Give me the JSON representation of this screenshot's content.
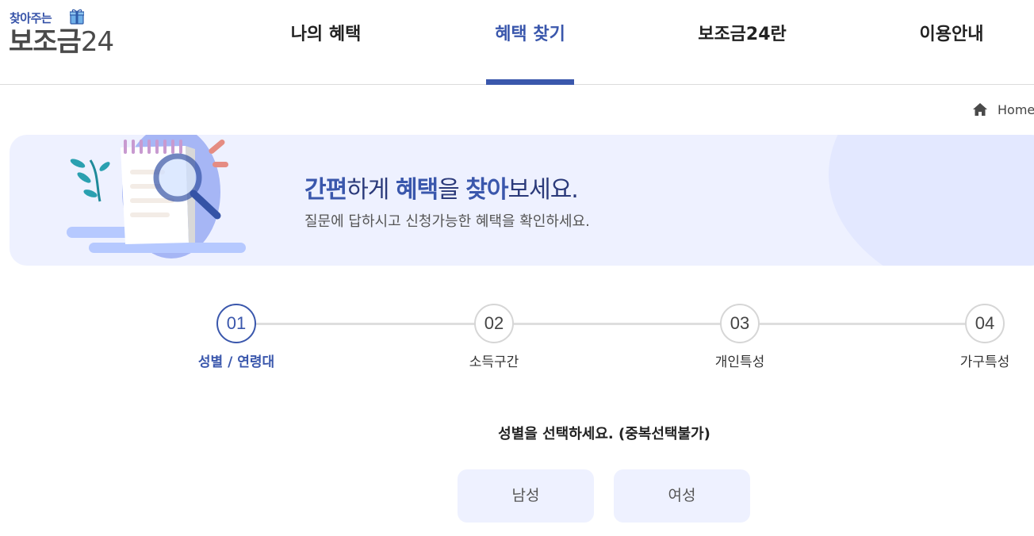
{
  "logo": {
    "top": "찾아주는",
    "main_text": "보조금",
    "main_num": "24"
  },
  "nav": {
    "items": [
      {
        "label": "나의 혜택"
      },
      {
        "label": "혜택 찾기"
      },
      {
        "label": "보조금24란"
      },
      {
        "label": "이용안내"
      }
    ],
    "active_index": 1
  },
  "breadcrumb": {
    "home": "Home"
  },
  "banner": {
    "title_parts": [
      "간편",
      "하게 ",
      "혜택",
      "을 ",
      "찾아",
      "보세요."
    ],
    "subtitle": "질문에 답하시고 신청가능한 혜택을 확인하세요."
  },
  "steps": [
    {
      "num": "01",
      "label": "성별 / 연령대",
      "active": true
    },
    {
      "num": "02",
      "label": "소득구간",
      "active": false
    },
    {
      "num": "03",
      "label": "개인특성",
      "active": false
    },
    {
      "num": "04",
      "label": "가구특성",
      "active": false
    }
  ],
  "question": {
    "prompt": "성별을 선택하세요. (중복선택불가)",
    "options": [
      "남성",
      "여성"
    ]
  },
  "colors": {
    "accent": "#3a57ac",
    "banner_bg": "#eef1ff",
    "option_bg": "#eef1ff"
  }
}
